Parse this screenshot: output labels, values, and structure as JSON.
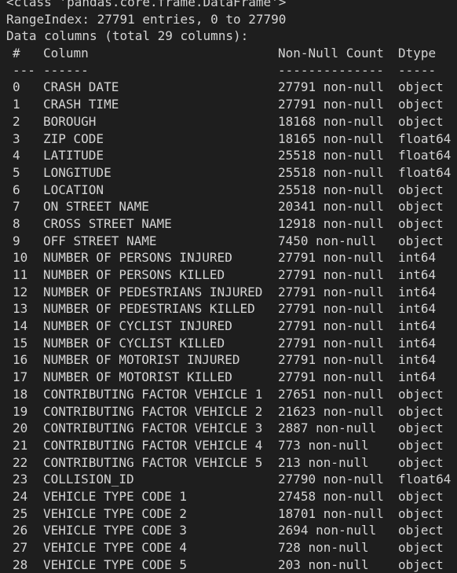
{
  "output": {
    "header_partial": "<class 'pandas.core.frame.DataFrame'>",
    "range_index": "RangeIndex: 27791 entries, 0 to 27790",
    "data_columns": "Data columns (total 29 columns):",
    "table_headers": {
      "idx": "#",
      "column": "Column",
      "non_null": "Non-Null Count",
      "dtype": "Dtype"
    },
    "table_separators": {
      "idx": "---",
      "column": "------",
      "non_null": "--------------",
      "dtype": "-----"
    },
    "rows": [
      {
        "idx": "0",
        "column": "CRASH DATE",
        "non_null": "27791 non-null",
        "dtype": "object"
      },
      {
        "idx": "1",
        "column": "CRASH TIME",
        "non_null": "27791 non-null",
        "dtype": "object"
      },
      {
        "idx": "2",
        "column": "BOROUGH",
        "non_null": "18168 non-null",
        "dtype": "object"
      },
      {
        "idx": "3",
        "column": "ZIP CODE",
        "non_null": "18165 non-null",
        "dtype": "float64"
      },
      {
        "idx": "4",
        "column": "LATITUDE",
        "non_null": "25518 non-null",
        "dtype": "float64"
      },
      {
        "idx": "5",
        "column": "LONGITUDE",
        "non_null": "25518 non-null",
        "dtype": "float64"
      },
      {
        "idx": "6",
        "column": "LOCATION",
        "non_null": "25518 non-null",
        "dtype": "object"
      },
      {
        "idx": "7",
        "column": "ON STREET NAME",
        "non_null": "20341 non-null",
        "dtype": "object"
      },
      {
        "idx": "8",
        "column": "CROSS STREET NAME",
        "non_null": "12918 non-null",
        "dtype": "object"
      },
      {
        "idx": "9",
        "column": "OFF STREET NAME",
        "non_null": "7450 non-null",
        "dtype": "object"
      },
      {
        "idx": "10",
        "column": "NUMBER OF PERSONS INJURED",
        "non_null": "27791 non-null",
        "dtype": "int64"
      },
      {
        "idx": "11",
        "column": "NUMBER OF PERSONS KILLED",
        "non_null": "27791 non-null",
        "dtype": "int64"
      },
      {
        "idx": "12",
        "column": "NUMBER OF PEDESTRIANS INJURED",
        "non_null": "27791 non-null",
        "dtype": "int64"
      },
      {
        "idx": "13",
        "column": "NUMBER OF PEDESTRIANS KILLED",
        "non_null": "27791 non-null",
        "dtype": "int64"
      },
      {
        "idx": "14",
        "column": "NUMBER OF CYCLIST INJURED",
        "non_null": "27791 non-null",
        "dtype": "int64"
      },
      {
        "idx": "15",
        "column": "NUMBER OF CYCLIST KILLED",
        "non_null": "27791 non-null",
        "dtype": "int64"
      },
      {
        "idx": "16",
        "column": "NUMBER OF MOTORIST INJURED",
        "non_null": "27791 non-null",
        "dtype": "int64"
      },
      {
        "idx": "17",
        "column": "NUMBER OF MOTORIST KILLED",
        "non_null": "27791 non-null",
        "dtype": "int64"
      },
      {
        "idx": "18",
        "column": "CONTRIBUTING FACTOR VEHICLE 1",
        "non_null": "27651 non-null",
        "dtype": "object"
      },
      {
        "idx": "19",
        "column": "CONTRIBUTING FACTOR VEHICLE 2",
        "non_null": "21623 non-null",
        "dtype": "object"
      },
      {
        "idx": "20",
        "column": "CONTRIBUTING FACTOR VEHICLE 3",
        "non_null": "2887 non-null",
        "dtype": "object"
      },
      {
        "idx": "21",
        "column": "CONTRIBUTING FACTOR VEHICLE 4",
        "non_null": "773 non-null",
        "dtype": "object"
      },
      {
        "idx": "22",
        "column": "CONTRIBUTING FACTOR VEHICLE 5",
        "non_null": "213 non-null",
        "dtype": "object"
      },
      {
        "idx": "23",
        "column": "COLLISION_ID",
        "non_null": "27790 non-null",
        "dtype": "float64"
      },
      {
        "idx": "24",
        "column": "VEHICLE TYPE CODE 1",
        "non_null": "27458 non-null",
        "dtype": "object"
      },
      {
        "idx": "25",
        "column": "VEHICLE TYPE CODE 2",
        "non_null": "18701 non-null",
        "dtype": "object"
      },
      {
        "idx": "26",
        "column": "VEHICLE TYPE CODE 3",
        "non_null": "2694 non-null",
        "dtype": "object"
      },
      {
        "idx": "27",
        "column": "VEHICLE TYPE CODE 4",
        "non_null": "728 non-null",
        "dtype": "object"
      },
      {
        "idx": "28",
        "column": "VEHICLE TYPE CODE 5",
        "non_null": "203 non-null",
        "dtype": "object"
      }
    ]
  }
}
